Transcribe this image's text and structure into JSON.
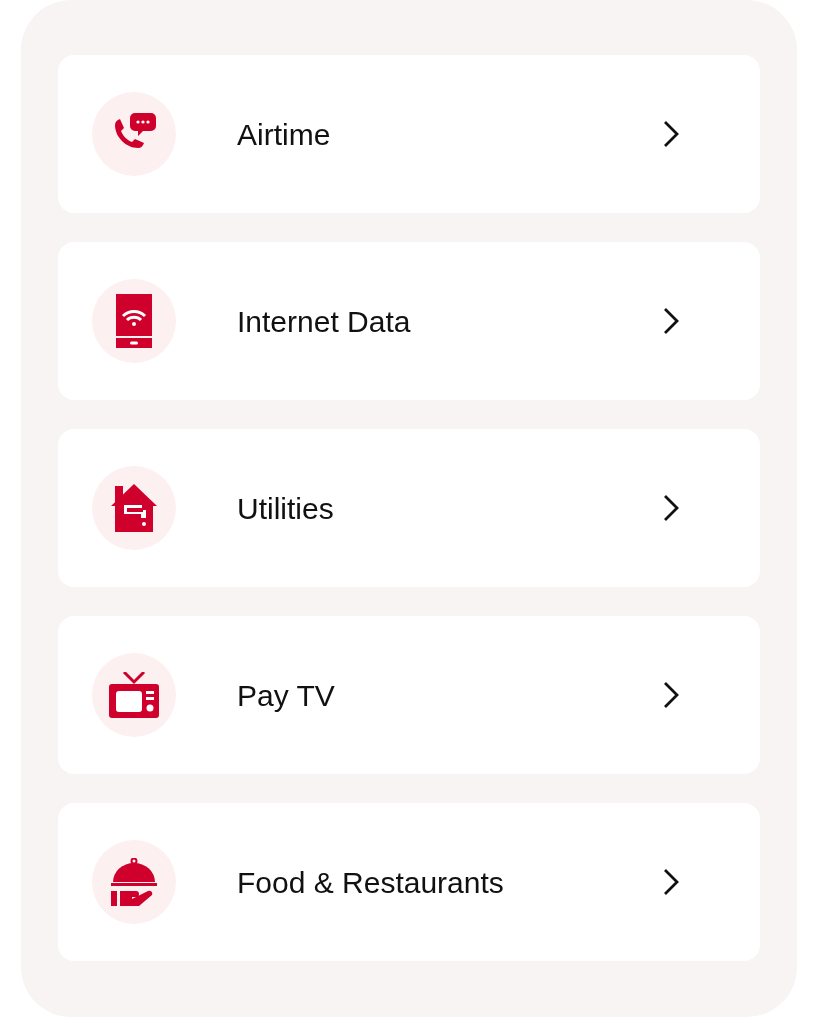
{
  "services": [
    {
      "kind": "phone",
      "label": "Airtime"
    },
    {
      "kind": "tablet",
      "label": "Internet Data"
    },
    {
      "kind": "house",
      "label": "Utilities"
    },
    {
      "kind": "tv",
      "label": "Pay TV"
    },
    {
      "kind": "food",
      "label": "Food & Restaurants"
    }
  ]
}
